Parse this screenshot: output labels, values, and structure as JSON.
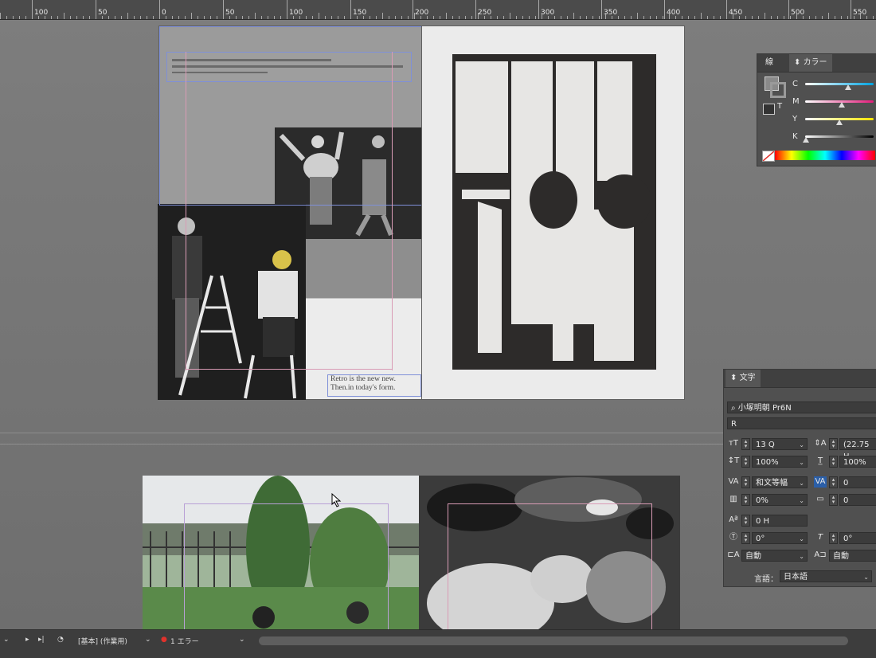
{
  "ruler": {
    "labels": [
      "100",
      "50",
      "0",
      "50",
      "100",
      "150",
      "200",
      "250",
      "300",
      "350",
      "400",
      "450",
      "500",
      "550"
    ]
  },
  "spread_top": {
    "text_frame_caption": {
      "line1": "Retro is the new new.",
      "line2": "Then.in today's form."
    }
  },
  "color_panel": {
    "tab_stroke": "線",
    "tab_color": "カラー",
    "channels": [
      {
        "label": "C",
        "level": 0.65
      },
      {
        "label": "M",
        "level": 0.52
      },
      {
        "label": "Y",
        "level": 0.5
      },
      {
        "label": "K",
        "level": 0.0
      }
    ],
    "text_icon": "T"
  },
  "character_panel": {
    "tab_label": "文字",
    "font_family": "小塚明朝 Pr6N",
    "font_style": "R",
    "size": "13 Q",
    "leading": "(22.75 H",
    "vertical_scale": "100%",
    "horizontal_scale": "100%",
    "kerning": "和文等幅",
    "tracking": "0",
    "tsume": "0%",
    "aki": "0",
    "baseline_shift": "0 H",
    "rotation": "0°",
    "skew": "0°",
    "aki_before": "自動",
    "aki_after": "自動",
    "language_label": "言語：",
    "language": "日本語"
  },
  "status_bar": {
    "preflight_profile": "[基本] (作業用)",
    "error_text": "1 エラー"
  },
  "colors": {
    "pasteboard": "#747474",
    "panel_bg": "#505050",
    "guide_blue": "#7f90d8",
    "guide_pink": "#d99bb5",
    "error_red": "#e0322c"
  }
}
